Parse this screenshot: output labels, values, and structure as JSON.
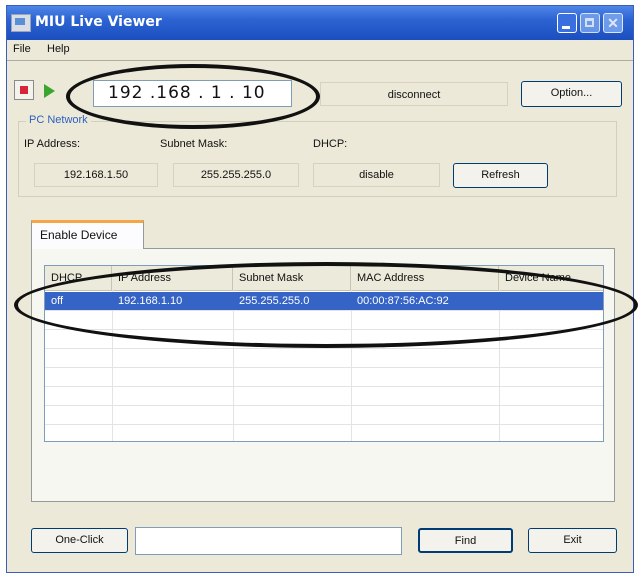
{
  "window": {
    "title": "MIU Live Viewer"
  },
  "menu": {
    "file": "File",
    "help": "Help"
  },
  "toolbar": {
    "ip_address": "192 .168 .  1  . 10",
    "status": "disconnect",
    "option_label": "Option..."
  },
  "pc_network": {
    "group_title": "PC Network",
    "ip_label": "IP Address:",
    "ip_value": "192.168.1.50",
    "subnet_label": "Subnet Mask:",
    "subnet_value": "255.255.255.0",
    "dhcp_label": "DHCP:",
    "dhcp_value": "disable",
    "refresh_label": "Refresh"
  },
  "tabs": {
    "enable_device": "Enable Device"
  },
  "device_table": {
    "columns": [
      "DHCP",
      "IP Address",
      "Subnet Mask",
      "MAC Address",
      "Device Name"
    ],
    "rows": [
      {
        "dhcp": "off",
        "ip": "192.168.1.10",
        "subnet": "255.255.255.0",
        "mac": "00:00:87:56:AC:92",
        "name": ""
      }
    ]
  },
  "footer": {
    "one_click_label": "One-Click",
    "status_value": "",
    "find_label": "Find",
    "exit_label": "Exit"
  },
  "colors": {
    "titlebar": "#2c63d2",
    "selection": "#3563c6",
    "group_title": "#2d5fc1",
    "tab_accent": "#f3a643",
    "stop_red": "#d8243a",
    "play_green": "#3aa62e"
  },
  "icons": [
    "app-icon",
    "stop-icon",
    "play-icon",
    "minimize-icon",
    "maximize-icon",
    "close-icon"
  ]
}
